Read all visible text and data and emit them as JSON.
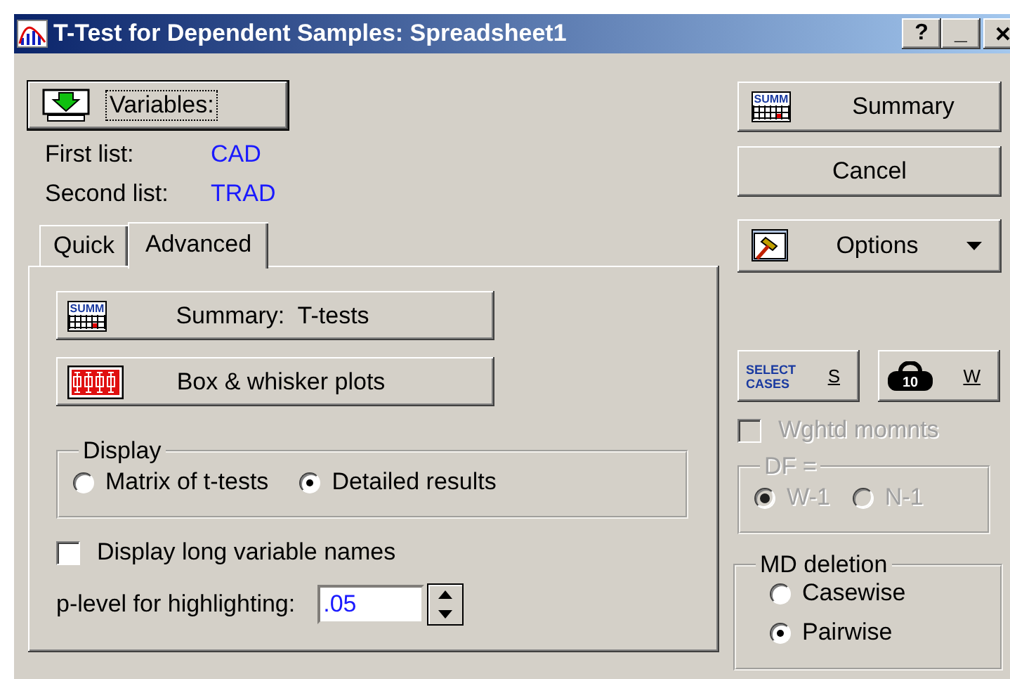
{
  "window": {
    "title": "T-Test for Dependent Samples: Spreadsheet1",
    "help_button": "?",
    "minimize_button": "_"
  },
  "variables_button": {
    "label": "Variables:"
  },
  "lists": [
    {
      "label": "First list:",
      "value": "CAD"
    },
    {
      "label": "Second list:",
      "value": "TRAD"
    }
  ],
  "tabs": [
    {
      "label": "Quick",
      "selected": false
    },
    {
      "label": "Advanced",
      "selected": true
    }
  ],
  "advanced": {
    "buttons": [
      {
        "kind": "summary",
        "label": "Summary:  T-tests",
        "icon_text": "SUMM"
      },
      {
        "kind": "boxplot",
        "label": "Box & whisker plots"
      }
    ],
    "display": {
      "title": "Display",
      "options": [
        {
          "label": "Matrix of t-tests",
          "selected": false
        },
        {
          "label": "Detailed results",
          "selected": true
        }
      ]
    },
    "long_names": {
      "label": "Display long variable names",
      "checked": false
    },
    "p_level": {
      "label": "p-level for highlighting:",
      "value": ".05"
    }
  },
  "side_buttons": [
    {
      "kind": "summary",
      "label": "Summary",
      "icon_text": "SUMM"
    },
    {
      "kind": "plain",
      "label": "Cancel"
    },
    {
      "kind": "options",
      "label": "Options"
    }
  ],
  "case_buttons": [
    {
      "kind": "select",
      "icon_text": "SELECT CASES",
      "key": "S"
    },
    {
      "kind": "weight",
      "icon_text": "10",
      "key": "W"
    }
  ],
  "weighted_moments": {
    "label": "Wghtd momnts",
    "checked": false,
    "disabled": true
  },
  "df": {
    "title": "DF =",
    "disabled": true,
    "options": [
      {
        "label": "W-1",
        "selected": true
      },
      {
        "label": "N-1",
        "selected": false
      }
    ]
  },
  "md_deletion": {
    "title": "MD deletion",
    "options": [
      {
        "label": "Casewise",
        "selected": false
      },
      {
        "label": "Pairwise",
        "selected": true
      }
    ]
  }
}
